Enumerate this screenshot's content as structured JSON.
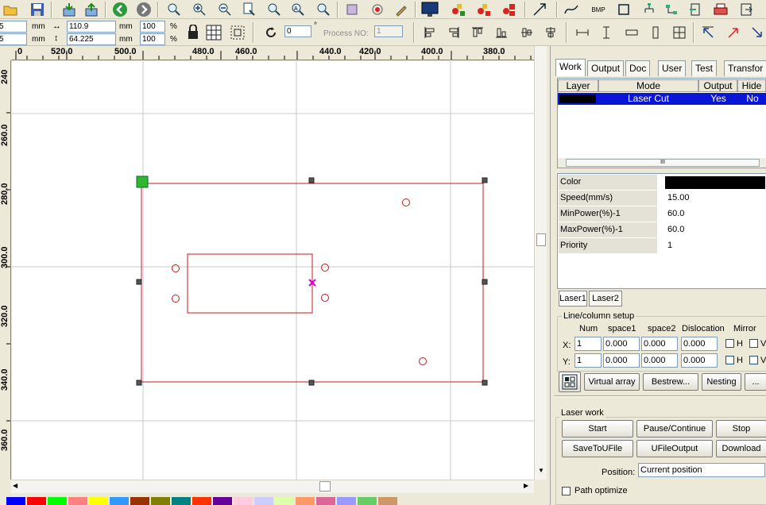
{
  "toolbar2": {
    "size_unit_1": "mm",
    "size_unit_2": "mm",
    "width_value": "110.9",
    "height_value": "64.225",
    "pos_x_left": "5",
    "pos_y_left": "5",
    "pos_unit_1": "mm",
    "pos_unit_2": "mm",
    "scale_x": "100",
    "scale_y": "100",
    "pct_1": "%",
    "pct_2": "%",
    "rotate_value": "0",
    "degree": "°",
    "process_no_label": "Process NO:",
    "process_no_value": "1"
  },
  "ruler_h": [
    "0",
    "520.0",
    "500.0",
    "480.0",
    "460.0",
    "440.0",
    "420.0",
    "400.0",
    "380.0"
  ],
  "ruler_v": [
    "240",
    "260.0",
    "280.0",
    "300.0",
    "320.0",
    "340.0",
    "360.0"
  ],
  "panel": {
    "tabs": [
      "Work",
      "Output",
      "Doc",
      "User",
      "Test",
      "Transfor"
    ],
    "layer_headers": [
      "Layer",
      "Mode",
      "Output",
      "Hide"
    ],
    "layer_row": {
      "mode": "Laser Cut",
      "output": "Yes",
      "hide": "No",
      "color": "#000000"
    },
    "scroll_label": "III",
    "props": [
      {
        "name": "Color",
        "value": ""
      },
      {
        "name": "Speed(mm/s)",
        "value": "15.00"
      },
      {
        "name": "MinPower(%)-1",
        "value": "60.0"
      },
      {
        "name": "MaxPower(%)-1",
        "value": "60.0"
      },
      {
        "name": "Priority",
        "value": "1"
      }
    ],
    "laser_tabs": [
      "Laser1",
      "Laser2"
    ],
    "line_col_title": "Line/column setup",
    "lc_headers": [
      "Num",
      "space1",
      "space2",
      "Dislocation",
      "Mirror"
    ],
    "row_x": {
      "label": "X:",
      "num": "1",
      "s1": "0.000",
      "s2": "0.000",
      "dis": "0.000",
      "h": "H",
      "v": "V"
    },
    "row_y": {
      "label": "Y:",
      "num": "1",
      "s1": "0.000",
      "s2": "0.000",
      "dis": "0.000",
      "h": "H",
      "v": "V"
    },
    "array_buttons": [
      "Virtual array",
      "Bestrew...",
      "Nesting",
      "..."
    ],
    "laser_work_title": "Laser work",
    "work_buttons": [
      "Start",
      "Pause/Continue",
      "Stop",
      "SaveToUFile",
      "UFileOutput",
      "Download"
    ],
    "position_label": "Position:",
    "position_value": "Current position",
    "path_label": "Path optimize"
  },
  "palette": [
    "#0000ff",
    "#ff0000",
    "#00ff00",
    "#ff8080",
    "#ffff00",
    "#3399ff",
    "#993300",
    "#808000",
    "#008080",
    "#ff3300",
    "#660099",
    "#ffccdd",
    "#ccccff",
    "#ddffaa",
    "#ff9966",
    "#dd6699",
    "#9999ff",
    "#66cc66",
    "#cc9966"
  ]
}
